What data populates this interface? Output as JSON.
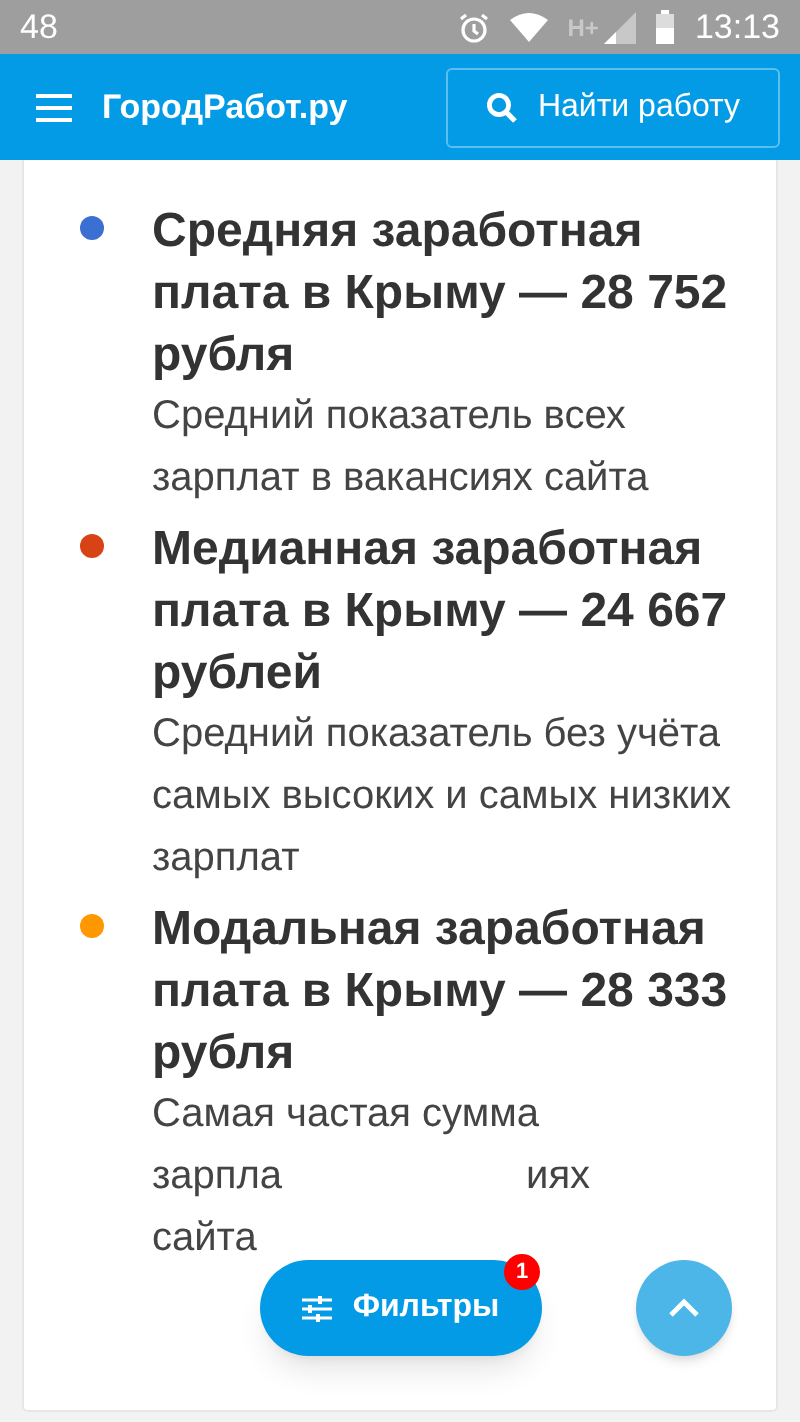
{
  "status_bar": {
    "notification": "48",
    "network": "H+",
    "time": "13:13"
  },
  "app_bar": {
    "title": "ГородРабот.ру",
    "search_button": "Найти работу"
  },
  "items": [
    {
      "color": "#3b6fd1",
      "title": "Средняя заработная плата в Крыму — 28 752 рубля",
      "description": "Средний показатель всех зарплат в вакансиях сайта"
    },
    {
      "color": "#d84315",
      "title": "Медианная заработная плата в Крыму — 24 667 рублей",
      "description": "Средний показатель без учёта самых высоких и самых низких зарплат"
    },
    {
      "color": "#ff9800",
      "title": "Модальная заработная плата в Крыму — 28 333 рубля",
      "description_visible": [
        [
          "Самая частая сумма"
        ],
        [
          "зарпла",
          "иях"
        ],
        [
          "сайта"
        ]
      ]
    }
  ],
  "filter_button": {
    "label": "Фильтры",
    "badge": "1"
  }
}
